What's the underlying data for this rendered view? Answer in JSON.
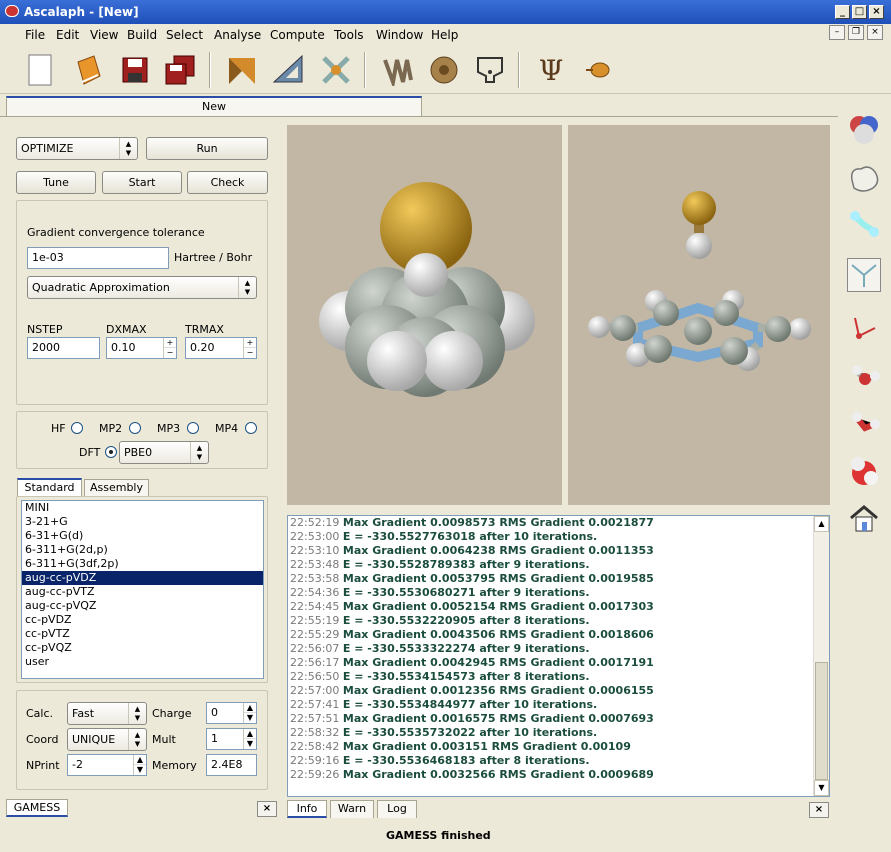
{
  "window": {
    "title": "Ascalaph - [New]",
    "min": "_",
    "max": "□",
    "close": "×"
  },
  "menu": [
    "File",
    "Edit",
    "View",
    "Build",
    "Select",
    "Analyse",
    "Compute",
    "Tools",
    "Window",
    "Help"
  ],
  "toolbar_icons": [
    "new-document-icon",
    "open-book-icon",
    "save-icon",
    "save-all-icon",
    "dock-icon",
    "measure-icon",
    "tools-icon",
    "protein-icon",
    "shell-icon",
    "potential-icon",
    "psi-icon",
    "pointer-icon"
  ],
  "doc_tab": "New",
  "panel": {
    "run_type": "OPTIMIZE",
    "run_button": "Run",
    "tune_button": "Tune",
    "start_button": "Start",
    "check_button": "Check",
    "gradient_label": "Gradient convergence tolerance",
    "gradient_value": "1e-03",
    "gradient_unit": "Hartree / Bohr",
    "method": "Quadratic Approximation",
    "nstep_label": "NSTEP",
    "nstep_value": "2000",
    "dxmax_label": "DXMAX",
    "dxmax_value": "0.10",
    "trmax_label": "TRMAX",
    "trmax_value": "0.20",
    "theory": {
      "hf": "HF",
      "mp2": "MP2",
      "mp3": "MP3",
      "mp4": "MP4",
      "dft": "DFT",
      "dft_functional": "PBE0",
      "selected": "DFT"
    },
    "basis_tabs": [
      "Standard",
      "Assembly"
    ],
    "basis_list": [
      "MINI",
      "3-21+G",
      "6-31+G(d)",
      "6-311+G(2d,p)",
      "6-311+G(3df,2p)",
      "aug-cc-pVDZ",
      "aug-cc-pVTZ",
      "aug-cc-pVQZ",
      "cc-pVDZ",
      "cc-pVTZ",
      "cc-pVQZ",
      "user"
    ],
    "basis_selected": "aug-cc-pVDZ",
    "calc_label": "Calc.",
    "calc_value": "Fast",
    "charge_label": "Charge",
    "charge_value": "0",
    "coord_label": "Coord",
    "coord_value": "UNIQUE",
    "mult_label": "Mult",
    "mult_value": "1",
    "nprint_label": "NPrint",
    "nprint_value": "-2",
    "memory_label": "Memory",
    "memory_value": "2.4E8",
    "bottom_tab": "GAMESS",
    "close": "×"
  },
  "log_tabs": [
    "Info",
    "Warn",
    "Log"
  ],
  "log": [
    {
      "time": "22:52:19",
      "msg": "Max Gradient 0.0098573    RMS Gradient 0.0021877"
    },
    {
      "time": "22:53:00",
      "msg": "E = -330.5527763018 after 10 iterations."
    },
    {
      "time": "22:53:10",
      "msg": "Max Gradient 0.0064238    RMS Gradient 0.0011353"
    },
    {
      "time": "22:53:48",
      "msg": "E = -330.5528789383 after 9 iterations."
    },
    {
      "time": "22:53:58",
      "msg": "Max Gradient 0.0053795    RMS Gradient 0.0019585"
    },
    {
      "time": "22:54:36",
      "msg": "E = -330.5530680271 after 9 iterations."
    },
    {
      "time": "22:54:45",
      "msg": "Max Gradient 0.0052154    RMS Gradient 0.0017303"
    },
    {
      "time": "22:55:19",
      "msg": "E = -330.5532220905 after 8 iterations."
    },
    {
      "time": "22:55:29",
      "msg": "Max Gradient 0.0043506    RMS Gradient 0.0018606"
    },
    {
      "time": "22:56:07",
      "msg": "E = -330.5533322274 after 9 iterations."
    },
    {
      "time": "22:56:17",
      "msg": "Max Gradient 0.0042945    RMS Gradient 0.0017191"
    },
    {
      "time": "22:56:50",
      "msg": "E = -330.5534154573 after 8 iterations."
    },
    {
      "time": "22:57:00",
      "msg": "Max Gradient 0.0012356    RMS Gradient 0.0006155"
    },
    {
      "time": "22:57:41",
      "msg": "E = -330.5534844977 after 10 iterations."
    },
    {
      "time": "22:57:51",
      "msg": "Max Gradient 0.0016575    RMS Gradient 0.0007693"
    },
    {
      "time": "22:58:32",
      "msg": "E = -330.5535732022 after 10 iterations."
    },
    {
      "time": "22:58:42",
      "msg": "Max Gradient 0.003151    RMS Gradient 0.00109"
    },
    {
      "time": "22:59:16",
      "msg": "E = -330.5536468183 after 8 iterations."
    },
    {
      "time": "22:59:26",
      "msg": "Max Gradient 0.0032566    RMS Gradient 0.0009689"
    }
  ],
  "status": "GAMESS finished",
  "right_icons": [
    "spacefill-icon",
    "surface-icon",
    "ball-stick-icon",
    "wireframe-icon",
    "sticks-icon",
    "water-ball-icon",
    "water-stick-icon",
    "water-sphere-icon",
    "home-icon"
  ],
  "colors": {
    "viewport_bg": "#c2b7a4",
    "selection": "#0a246a",
    "title_blue": "#2a5bd0"
  }
}
